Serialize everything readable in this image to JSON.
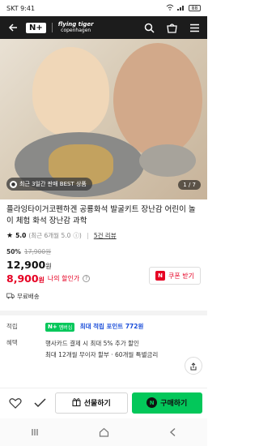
{
  "status": {
    "carrier": "SKT 9:41",
    "battery": "88"
  },
  "header": {
    "logo": "N+",
    "brand_line1": "flying tiger",
    "brand_line2": "copenhagen"
  },
  "hero": {
    "badge": "최근 3일간 판매 BEST 상품",
    "pager": "1 / 7"
  },
  "product": {
    "title": "플라잉타이거코펜하겐 공룡화석 발굴키트 장난감 어린이 놀이 체험 화석 장난감 과학",
    "rating": "5.0",
    "rating_sub": "(최근 6개월 5.0",
    "reviews": "5건 리뷰",
    "discount_pct": "50%",
    "original_price": "17,900원",
    "price": "12,900",
    "price_unit": "원",
    "my_price": "8,900",
    "my_price_unit": "원",
    "my_price_label": "나의 할인가",
    "coupon_label": "쿠폰 받기",
    "shipping": "무료배송"
  },
  "info": {
    "points_label": "적립",
    "np_badge": "N+",
    "np_badge_sub": "멤버십",
    "points_value": "최대 적립 포인트 772원",
    "benefit_label": "혜택",
    "benefit_line1": "행사카드 결제 시 최대 5% 추가 할인",
    "benefit_line2": "최대 12개월 무이자 할부 · 60개월 특별금리"
  },
  "bottom": {
    "gift_label": "선물하기",
    "buy_label": "구매하기",
    "buy_icon": "N"
  },
  "colors": {
    "accent_red": "#e60023",
    "naver_green": "#03c75a",
    "point_blue": "#1a4dd9"
  }
}
